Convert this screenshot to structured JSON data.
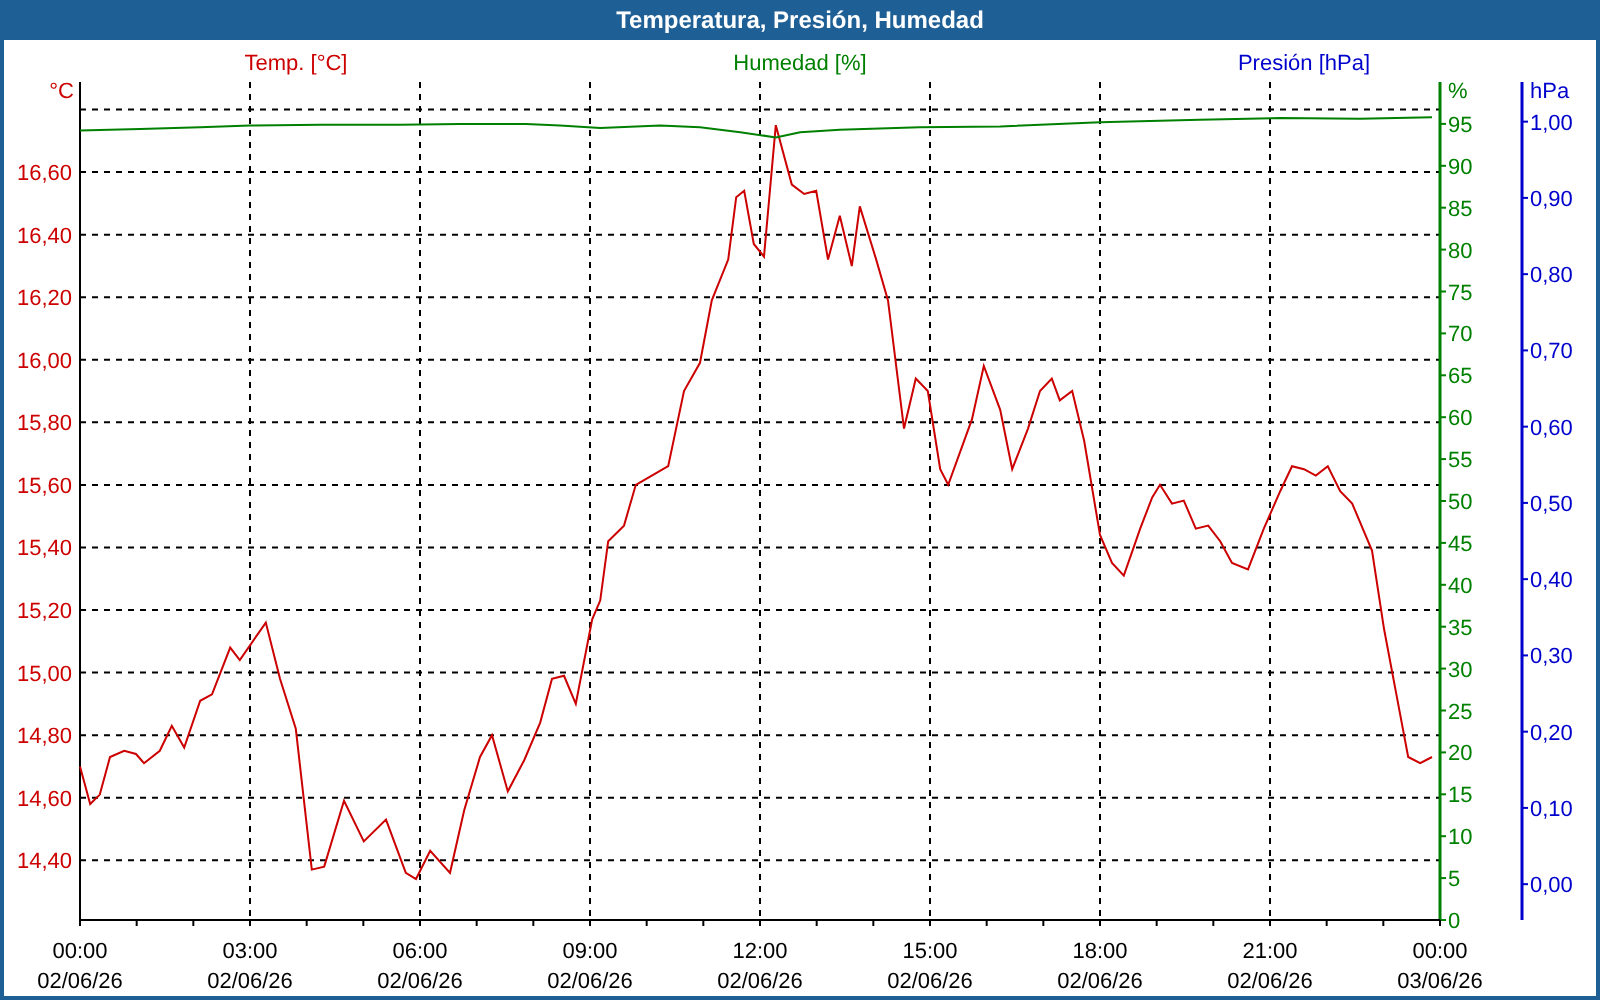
{
  "window": {
    "title": "Temperatura, Presión, Humedad"
  },
  "chart_data": {
    "type": "line",
    "xlim": [
      0,
      24
    ],
    "xticks": [
      {
        "value": 0,
        "label": "00:00"
      },
      {
        "value": 3,
        "label": "03:00"
      },
      {
        "value": 6,
        "label": "06:00"
      },
      {
        "value": 9,
        "label": "09:00"
      },
      {
        "value": 12,
        "label": "12:00"
      },
      {
        "value": 15,
        "label": "15:00"
      },
      {
        "value": 18,
        "label": "18:00"
      },
      {
        "value": 21,
        "label": "21:00"
      },
      {
        "value": 24,
        "label": "00:00"
      }
    ],
    "annotations": [
      "02/06/26",
      "02/06/26",
      "02/06/26",
      "02/06/26",
      "02/06/26",
      "02/06/26",
      "02/06/26",
      "02/06/26",
      "03/06/26"
    ],
    "grid": true,
    "ylabel": "°C",
    "ylim": [
      14.209,
      16.888
    ],
    "yticks": [
      {
        "value": 14.4,
        "label": "14,40"
      },
      {
        "value": 14.6,
        "label": "14,60"
      },
      {
        "value": 14.8,
        "label": "14,80"
      },
      {
        "value": 15.0,
        "label": "15,00"
      },
      {
        "value": 15.2,
        "label": "15,20"
      },
      {
        "value": 15.4,
        "label": "15,40"
      },
      {
        "value": 15.6,
        "label": "15,60"
      },
      {
        "value": 15.8,
        "label": "15,80"
      },
      {
        "value": 16.0,
        "label": "16,00"
      },
      {
        "value": 16.2,
        "label": "16,20"
      },
      {
        "value": 16.4,
        "label": "16,40"
      },
      {
        "value": 16.6,
        "label": "16,60"
      }
    ],
    "y2label": "%",
    "y2lim": [
      0,
      100
    ],
    "y2ticks": [
      {
        "value": 0,
        "label": "0"
      },
      {
        "value": 5,
        "label": "5"
      },
      {
        "value": 10,
        "label": "10"
      },
      {
        "value": 15,
        "label": "15"
      },
      {
        "value": 20,
        "label": "20"
      },
      {
        "value": 25,
        "label": "25"
      },
      {
        "value": 30,
        "label": "30"
      },
      {
        "value": 35,
        "label": "35"
      },
      {
        "value": 40,
        "label": "40"
      },
      {
        "value": 45,
        "label": "45"
      },
      {
        "value": 50,
        "label": "50"
      },
      {
        "value": 55,
        "label": "55"
      },
      {
        "value": 60,
        "label": "60"
      },
      {
        "value": 65,
        "label": "65"
      },
      {
        "value": 70,
        "label": "70"
      },
      {
        "value": 75,
        "label": "75"
      },
      {
        "value": 80,
        "label": "80"
      },
      {
        "value": 85,
        "label": "85"
      },
      {
        "value": 90,
        "label": "90"
      },
      {
        "value": 95,
        "label": "95"
      }
    ],
    "y3label": "hPa",
    "y3lim": [
      -0.047,
      1.052
    ],
    "y3ticks": [
      {
        "value": 0,
        "label": "0,00"
      },
      {
        "value": 0.1,
        "label": "0,10"
      },
      {
        "value": 0.2,
        "label": "0,20"
      },
      {
        "value": 0.3,
        "label": "0,30"
      },
      {
        "value": 0.4,
        "label": "0,40"
      },
      {
        "value": 0.5,
        "label": "0,50"
      },
      {
        "value": 0.6,
        "label": "0,60"
      },
      {
        "value": 0.7,
        "label": "0,70"
      },
      {
        "value": 0.8,
        "label": "0,80"
      },
      {
        "value": 0.9,
        "label": "0,90"
      },
      {
        "value": 1.0,
        "label": "1,00"
      }
    ],
    "series": [
      {
        "name": "Temp. [°C]",
        "color": "#cc0000",
        "x": [
          0,
          0.18,
          0.35,
          0.53,
          0.78,
          0.99,
          1.13,
          1.41,
          1.62,
          1.84,
          2.12,
          2.33,
          2.65,
          2.82,
          3.28,
          3.53,
          3.81,
          4.09,
          4.31,
          4.66,
          5.01,
          5.4,
          5.75,
          5.93,
          6.18,
          6.53,
          6.78,
          7.06,
          7.27,
          7.55,
          7.84,
          8.12,
          8.33,
          8.54,
          8.75,
          9.04,
          9.18,
          9.32,
          9.6,
          9.81,
          10.09,
          10.38,
          10.66,
          10.94,
          11.15,
          11.44,
          11.58,
          11.72,
          11.89,
          12.07,
          12.28,
          12.56,
          12.78,
          12.99,
          13.2,
          13.41,
          13.62,
          13.76,
          14.05,
          14.26,
          14.54,
          14.75,
          14.96,
          15.18,
          15.32,
          15.74,
          15.95,
          16.24,
          16.45,
          16.73,
          16.94,
          17.15,
          17.29,
          17.51,
          17.72,
          18.0,
          18.21,
          18.42,
          18.71,
          18.92,
          19.06,
          19.27,
          19.48,
          19.69,
          19.91,
          20.12,
          20.33,
          20.61,
          20.89,
          21.18,
          21.39,
          21.6,
          21.81,
          22.02,
          22.24,
          22.45,
          22.8,
          23.01,
          23.22,
          23.44,
          23.65,
          23.86
        ],
        "values": [
          14.7,
          14.58,
          14.61,
          14.73,
          14.75,
          14.74,
          14.71,
          14.75,
          14.83,
          14.76,
          14.91,
          14.93,
          15.08,
          15.04,
          15.16,
          14.98,
          14.82,
          14.37,
          14.38,
          14.59,
          14.46,
          14.53,
          14.36,
          14.34,
          14.43,
          14.36,
          14.56,
          14.73,
          14.8,
          14.62,
          14.72,
          14.84,
          14.98,
          14.99,
          14.9,
          15.17,
          15.23,
          15.42,
          15.47,
          15.6,
          15.63,
          15.66,
          15.9,
          15.99,
          16.19,
          16.32,
          16.52,
          16.54,
          16.37,
          16.33,
          16.75,
          16.56,
          16.53,
          16.54,
          16.32,
          16.46,
          16.3,
          16.49,
          16.32,
          16.19,
          15.78,
          15.94,
          15.9,
          15.65,
          15.6,
          15.81,
          15.98,
          15.84,
          15.65,
          15.78,
          15.9,
          15.94,
          15.87,
          15.9,
          15.74,
          15.44,
          15.35,
          15.31,
          15.46,
          15.56,
          15.6,
          15.54,
          15.55,
          15.46,
          15.47,
          15.42,
          15.35,
          15.33,
          15.46,
          15.58,
          15.66,
          15.65,
          15.63,
          15.66,
          15.58,
          15.54,
          15.39,
          15.14,
          14.94,
          14.73,
          14.71,
          14.73
        ]
      },
      {
        "name": "Humedad [%]",
        "color": "#008000",
        "axis": "y2",
        "x": [
          0,
          1.06,
          2.12,
          3.0,
          4.24,
          5.65,
          6.71,
          7.87,
          8.47,
          9.18,
          10.24,
          10.94,
          11.65,
          12.28,
          12.71,
          13.41,
          14.82,
          16.24,
          18.0,
          19.76,
          21.18,
          22.59,
          23.86
        ],
        "values": [
          94.2,
          94.4,
          94.6,
          94.8,
          94.9,
          94.9,
          95.0,
          95.0,
          94.8,
          94.5,
          94.8,
          94.6,
          94.0,
          93.4,
          94.0,
          94.3,
          94.6,
          94.7,
          95.2,
          95.5,
          95.7,
          95.6,
          95.8
        ]
      },
      {
        "name": "Presión [hPa]",
        "color": "#0000cc",
        "axis": "y3",
        "values": [
          null,
          null
        ]
      }
    ]
  }
}
